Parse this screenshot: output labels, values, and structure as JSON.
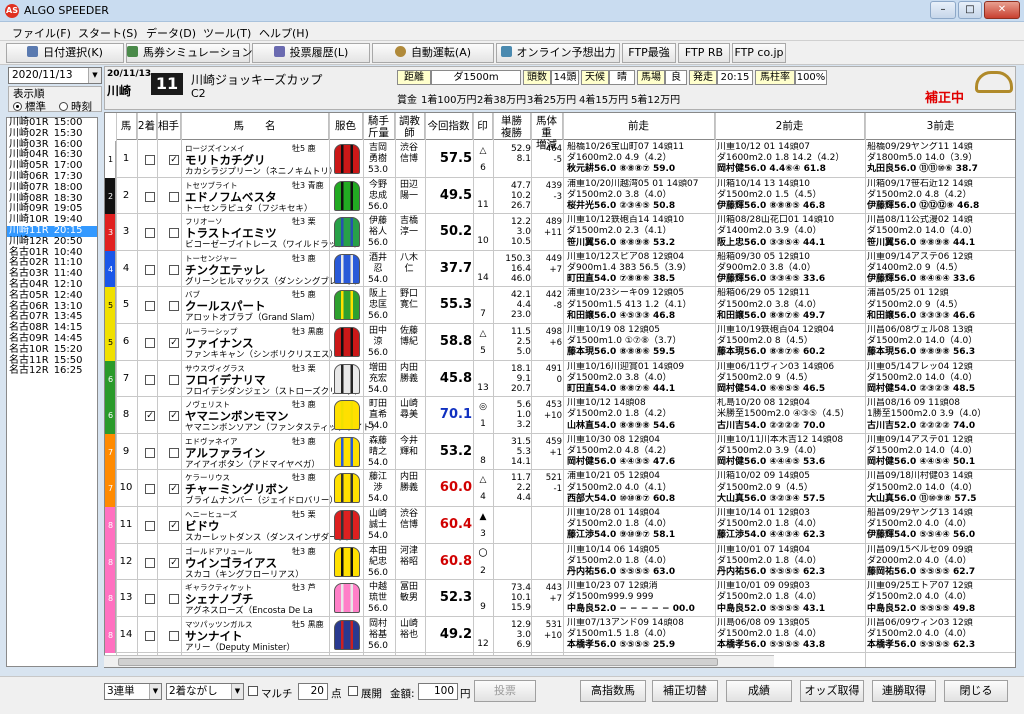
{
  "window": {
    "title": "ALGO SPEEDER",
    "logo_text": "AS",
    "min": "–",
    "max": "□",
    "close": "✕"
  },
  "menu": [
    "ファイル(F)",
    "スタート(S)",
    "データ(D)",
    "ツール(T)",
    "ヘルプ(H)"
  ],
  "toolbar": {
    "date_select": "日付選択(K)",
    "baken_sim": "馬券シミュレーション(B)",
    "history": "投票履歴(L)",
    "auto_vote": "自動運転(A)",
    "online": "オンライン予想出力",
    "ftp_strong": "FTP最強",
    "ftp_rb": "FTP RB",
    "ftp_cojp": "FTP co.jp"
  },
  "left": {
    "date": "2020/11/13",
    "sort_title": "表示順",
    "sort_std": "標準",
    "sort_time": "時刻",
    "races": [
      {
        "label": "川崎01R",
        "time": "15:00"
      },
      {
        "label": "川崎02R",
        "time": "15:30"
      },
      {
        "label": "川崎03R",
        "time": "16:00"
      },
      {
        "label": "川崎04R",
        "time": "16:30"
      },
      {
        "label": "川崎05R",
        "time": "17:00"
      },
      {
        "label": "川崎06R",
        "time": "17:30"
      },
      {
        "label": "川崎07R",
        "time": "18:00"
      },
      {
        "label": "川崎08R",
        "time": "18:30"
      },
      {
        "label": "川崎09R",
        "time": "19:05"
      },
      {
        "label": "川崎10R",
        "time": "19:40"
      },
      {
        "label": "川崎11R",
        "time": "20:15"
      },
      {
        "label": "川崎12R",
        "time": "20:50"
      },
      {
        "label": "名古01R",
        "time": "10:40"
      },
      {
        "label": "名古02R",
        "time": "11:10"
      },
      {
        "label": "名古03R",
        "time": "11:40"
      },
      {
        "label": "名古04R",
        "time": "12:10"
      },
      {
        "label": "名古05R",
        "time": "12:40"
      },
      {
        "label": "名古06R",
        "time": "13:10"
      },
      {
        "label": "名古07R",
        "time": "13:45"
      },
      {
        "label": "名古08R",
        "time": "14:15"
      },
      {
        "label": "名古09R",
        "time": "14:45"
      },
      {
        "label": "名古10R",
        "time": "15:20"
      },
      {
        "label": "名古11R",
        "time": "15:50"
      },
      {
        "label": "名古12R",
        "time": "16:25"
      }
    ]
  },
  "race": {
    "date": "20/11/13",
    "venue": "川崎",
    "num": "11",
    "name": "川崎ジョッキーズカップ",
    "class": "C2",
    "dist_label": "距離",
    "dist": "ダ1500m",
    "heads_label": "頭数",
    "heads": "14頭",
    "weather_label": "天候",
    "weather": "晴",
    "track_label": "馬場",
    "track": "良",
    "post_label": "発走",
    "post": "20:15",
    "rate_label": "馬柱率",
    "rate": "100%",
    "prize_label": "賞金",
    "p1": "1着100万円",
    "p2": "2着38万円",
    "p3": "3着25万円",
    "p4": "4着15万円",
    "p5": "5着12万円",
    "hosei": "補正中"
  },
  "cols": {
    "uma": "馬",
    "second": "2着",
    "aite": "相手",
    "name": "馬　　名",
    "silk": "服色",
    "jockey": "騎手\n斤量",
    "trainer": "調教\n師",
    "index": "今回指数",
    "mark": "印",
    "odds": "単勝\n複勝",
    "weight": "馬体重\n増減",
    "prev1": "前走",
    "prev2": "2前走",
    "prev3": "3前走"
  },
  "horses": [
    {
      "waku": "1",
      "num": "1",
      "c2": false,
      "aite": true,
      "sire": "ロージズインメイ",
      "name": "モリトカチグリ",
      "dam": "カカシラジプリーン（ネニノキムトリ）",
      "sexage": "牡5 鹿",
      "jockey": "吉岡\n勇樹\n53.0",
      "trainer": "渋谷\n信博",
      "score": "57.5",
      "mark": "△",
      "mark2": "6",
      "odds": "52.9\n8.1",
      "wt": "464\n-5",
      "p1": [
        "船橋10/26宝山町07 14頭11",
        "ダ1600m2.0 4.9（4.2）",
        "秋元耕56.0 ⑧⑧⑧⑦ 59.0"
      ],
      "p2": [
        "川重10/12 01 14頭07",
        "ダ1600m2.0 1.8 14.2（4.2）",
        "岡村健56.0 4.4⑥④ 61.8"
      ],
      "p3": [
        "船橋09/29ヤング11 14頭",
        "ダ1800m5.0 14.0（3.9）",
        "丸田良56.0 ⑪⑪⑩⑥ 38.7"
      ]
    },
    {
      "waku": "2",
      "num": "2",
      "c2": false,
      "aite": false,
      "sire": "トセツブライト",
      "name": "エドノフムベスタ",
      "dam": "トーセンラピュタ（フジキセキ）",
      "sexage": "牡3 青鹿",
      "jockey": "今野\n忠成\n56.0",
      "trainer": "田辺\n陽一",
      "score": "49.5",
      "mark": "",
      "mark2": "11",
      "odds": "47.7\n10.2\n26.7",
      "wt": "439\n-3",
      "p1": [
        "浦重10/20川越湾05 01 14頭07",
        "ダ1500m2.0 3.8（4.0）",
        "桜井光56.0 ②③④⑤ 50.8"
      ],
      "p2": [
        "川箱10/14 13 14頭10",
        "ダ1500m2.0 1.5（4.5）",
        "伊藤輝56.0 ⑧⑧⑧⑤ 46.8"
      ],
      "p3": [
        "川箱09/17笹石近12 14頭",
        "ダ1500m2.0 4.8（4.2）",
        "伊藤輝56.0 ⑫⑫⑫⑧ 46.8"
      ]
    },
    {
      "waku": "3",
      "num": "3",
      "c2": false,
      "aite": false,
      "sire": "フリオーソ",
      "name": "トラストイエミツ",
      "dam": "ビコーゼーブイトレース（ワイルドラッシュ）",
      "sexage": "牡3 栗",
      "jockey": "伊藤\n裕人\n56.0",
      "trainer": "吉橋\n淳一",
      "score": "50.2",
      "mark": "",
      "mark2": "10",
      "odds": "12.2\n3.0\n10.5",
      "wt": "489\n+11",
      "p1": [
        "川重10/12鉄砲百14 14頭10",
        "ダ1500m2.0 2.3（4.1）",
        "笹川翼56.0 ⑧⑧⑨⑧ 53.2"
      ],
      "p2": [
        "川箱08/28山花口01 14頭10",
        "ダ1400m2.0 3.9（4.0）",
        "阪上忠56.0 ③③⑤④ 44.1"
      ],
      "p3": [
        "川昌08/11公式漫02 14頭",
        "ダ1500m2.0 14.0（4.0）",
        "笹川翼56.0 ⑨⑧⑨⑧ 44.1"
      ]
    },
    {
      "waku": "4",
      "num": "4",
      "c2": false,
      "aite": false,
      "sire": "トーセンジャー",
      "name": "チンクエテッレ",
      "dam": "グリーンヒルマックス（ダンシングブレーヴ）",
      "sexage": "牡3 鹿",
      "jockey": "酒井\n忍\n54.0",
      "trainer": "八木\n仁",
      "score": "37.7",
      "mark": "",
      "mark2": "14",
      "odds": "150.3\n16.4\n46.0",
      "wt": "449\n+7",
      "p1": [
        "川重10/12スピア08 12頭04",
        "ダ900m1.4 383 56.5（3.9）",
        "町田直54.0 ⑦⑧⑧⑥ 38.5"
      ],
      "p2": [
        "船箱09/30 05 12頭10",
        "ダ900m2.0 3.8（4.0）",
        "伊藤輝56.0 ③③④⑤ 33.6"
      ],
      "p3": [
        "川重09/14アステ06 12頭",
        "ダ1400m2.0 9（4.5）",
        "伊藤輝56.0 ⑧④⑥④ 33.6"
      ]
    },
    {
      "waku": "5",
      "num": "5",
      "c2": false,
      "aite": false,
      "sire": "バブ",
      "name": "クールスパート",
      "dam": "アロットオブラブ（Grand Slam）",
      "sexage": "牡5 鹿",
      "jockey": "阪上\n忠匡\n56.0",
      "trainer": "野口\n寛仁",
      "score": "55.3",
      "mark": "",
      "mark2": "7",
      "odds": "42.1\n4.4\n23.0",
      "wt": "442\n-8",
      "p1": [
        "浦重10/23シーキ09 12頭05",
        "ダ1500m1.5 413 1.2（4.1）",
        "和田譲56.0 ④⑤③③ 46.8"
      ],
      "p2": [
        "船箱06/29 05 12頭11",
        "ダ1500m2.0 3.8（4.0）",
        "和田譲56.0 ⑧⑧⑦⑥ 49.7"
      ],
      "p3": [
        "浦昌05/25 01 12頭",
        "ダ1500m2.0 9（4.5）",
        "和田譲56.0 ③③③③ 46.6"
      ]
    },
    {
      "waku": "5",
      "num": "6",
      "c2": false,
      "aite": true,
      "sire": "ルーラーシップ",
      "name": "ファイナンス",
      "dam": "ファンキキャン（シンボリクリスエス）",
      "sexage": "牡3 黒鹿",
      "jockey": "田中\n涼\n56.0",
      "trainer": "佐藤\n博紀",
      "score": "58.8",
      "mark": "△",
      "mark2": "5",
      "odds": "11.5\n2.5\n5.0",
      "wt": "498\n+6",
      "p1": [
        "川重10/19 08 12頭05",
        "ダ1500m1.0 ①⑦⑧（3.7）",
        "藤本現56.0 ⑧⑧⑧⑥ 59.5"
      ],
      "p2": [
        "川重10/19鉄砲百04 12頭04",
        "ダ1500m2.0 8（4.5）",
        "藤本現56.0 ⑧⑧⑦⑥ 60.2"
      ],
      "p3": [
        "川昌06/08ヴェル08 13頭",
        "ダ1500m2.0 14.0（4.0）",
        "藤本現56.0 ⑨⑧⑨⑧ 56.3"
      ]
    },
    {
      "waku": "6",
      "num": "7",
      "c2": false,
      "aite": false,
      "sire": "サウスヴィグラス",
      "name": "フロイデナリマ",
      "dam": "フロイデシダンジェン（ストローズクリーク）",
      "sexage": "牡3 栗",
      "jockey": "増田\n充宏\n54.0",
      "trainer": "内田\n勝義",
      "score": "45.8",
      "mark": "",
      "mark2": "13",
      "odds": "18.1\n9.1\n20.7",
      "wt": "491\n0",
      "p1": [
        "川重10/16川迎賞01 14頭09",
        "ダ1500m2.0 3.8（4.0）",
        "町田直54.0 ⑧⑧⑦⑥ 44.1"
      ],
      "p2": [
        "川重06/11ヴィン03 14頭06",
        "ダ1500m2.0 9（4.5）",
        "岡村健54.0 ⑥⑥⑤⑤ 46.5"
      ],
      "p3": [
        "川重05/14ブレッ04 12頭",
        "ダ1500m2.0 14.0（4.0）",
        "岡村健54.0 ②③②③ 48.5"
      ]
    },
    {
      "waku": "6",
      "num": "8",
      "c2": true,
      "aite": true,
      "sire": "ノヴェリスト",
      "name": "ヤマニンボンモマン",
      "dam": "ヤマニンボンソアン（ファンタスティックライト）",
      "sexage": "牡3 鹿",
      "jockey": "町田\n直希\n54.0",
      "trainer": "山崎\n尋美",
      "score": "70.1",
      "mark": "◎",
      "mark2": "1",
      "odds": "5.6\n1.0\n3.2",
      "wt": "453\n+10",
      "p1": [
        "川重10/12 14頭08",
        "ダ1500m2.0 1.8（4.2）",
        "山林直54.0 ⑧⑧⑨⑧ 54.6"
      ],
      "p2": [
        "札島10/20 08 12頭04",
        "米勝至1500m2.0 ④③⑤（4.5）",
        "古川吉54.0 ②②②② 70.0"
      ],
      "p3": [
        "川昌08/16 09 11頭08",
        "1勝至1500m2.0 3.9（4.0）",
        "古川吉52.0 ②②②② 74.0"
      ]
    },
    {
      "waku": "7",
      "num": "9",
      "c2": false,
      "aite": false,
      "sire": "エドヴァネイア",
      "name": "アルファライン",
      "dam": "アイアイボタン（アドマイヤベガ）",
      "sexage": "牡3 鹿",
      "jockey": "森藤\n晴之\n54.0",
      "trainer": "今井\n輝和",
      "score": "53.2",
      "mark": "",
      "mark2": "8",
      "odds": "31.5\n5.3\n14.1",
      "wt": "459\n+1",
      "p1": [
        "川重10/30 08 12頭04",
        "ダ1500m2.0 4.8（4.2）",
        "岡村健56.0 ④④③⑤ 47.6"
      ],
      "p2": [
        "川重10/11川本木吉12 14頭08",
        "ダ1500m2.0 3.9（4.0）",
        "岡村健56.0 ④④④⑤ 53.6"
      ],
      "p3": [
        "川重09/14アステ01 12頭",
        "ダ1500m2.0 14.0（4.0）",
        "岡村健56.0 ④④⑤④ 50.1"
      ]
    },
    {
      "waku": "7",
      "num": "10",
      "c2": false,
      "aite": true,
      "sire": "ケラーリウス",
      "name": "チャーミングリボン",
      "dam": "ブライムナンバー（ジェイドロバリー）",
      "sexage": "牡3 鹿",
      "jockey": "藤江\n渉\n54.0",
      "trainer": "内田\n勝義",
      "score": "60.0",
      "mark": "△",
      "mark2": "4",
      "odds": "11.7\n2.2\n4.4",
      "wt": "521\n-1",
      "p1": [
        "浦重10/21 05 12頭04",
        "ダ1500m2.0 4.0（4.1）",
        "西部大54.0 ⑩⑩⑧⑦ 60.8"
      ],
      "p2": [
        "川箱10/02 09 14頭05",
        "ダ1500m2.0 9（4.5）",
        "大山真56.0 ③②③④ 57.5"
      ],
      "p3": [
        "川昌09/18川村健03 14頭",
        "ダ1500m2.0 14.0（4.0）",
        "大山真56.0 ⑪⑩⑨⑧ 57.5"
      ]
    },
    {
      "waku": "8",
      "num": "11",
      "c2": false,
      "aite": true,
      "sire": "ヘニーヒューズ",
      "name": "ビドウ",
      "dam": "スカーレットダンス（ダンスインザダーク）",
      "sexage": "牡5 栗",
      "jockey": "山崎\n誠士\n54.0",
      "trainer": "渋谷\n信博",
      "score": "60.4",
      "mark": "▲",
      "mark2": "3",
      "odds": "",
      "wt": "",
      "p1": [
        "川重10/28 01 14頭04",
        "ダ1500m2.0 1.8（4.0）",
        "藤江渉54.0 ⑨⑩⑨⑦ 58.1"
      ],
      "p2": [
        "川重10/14 01 12頭03",
        "ダ1500m2.0 1.8（4.0）",
        "藤江渉54.0 ④④③④ 62.3"
      ],
      "p3": [
        "船昌09/29ヤング13 14頭",
        "ダ1500m2.0 4.0（4.0）",
        "伊藤輝54.0 ⑤⑤④④ 56.0"
      ]
    },
    {
      "waku": "8",
      "num": "12",
      "c2": false,
      "aite": true,
      "sire": "ゴールドアリュール",
      "name": "ウインゴライアス",
      "dam": "スカコ（キングフローリアス）",
      "sexage": "牡3 鹿",
      "jockey": "本田\n紀忠\n56.0",
      "trainer": "河津\n裕昭",
      "score": "60.8",
      "mark": "〇",
      "mark2": "2",
      "odds": "",
      "wt": "",
      "p1": [
        "川重10/14 06 14頭05",
        "ダ1500m2.0 1.8（4.0）",
        "丹内祐56.0 ⑤⑤⑤⑤ 63.0"
      ],
      "p2": [
        "川重10/01 07 14頭04",
        "ダ1500m2.0 1.8（4.0）",
        "丹内祐56.0 ⑤⑤⑤⑤ 62.3"
      ],
      "p3": [
        "川昌09/15ベルセ09 09頭",
        "ダ2000m2.0 4.0（4.0）",
        "藤岡祐56.0 ⑤⑤⑤⑤ 62.7"
      ]
    },
    {
      "waku": "8",
      "num": "13",
      "c2": false,
      "aite": false,
      "sire": "ギャラクティケット",
      "name": "シェナノブチ",
      "dam": "アグネスローズ（Encosta De La",
      "sexage": "牡3 芦",
      "jockey": "中越\n琉世\n56.0",
      "trainer": "冨田\n敏男",
      "score": "52.3",
      "mark": "",
      "mark2": "9",
      "odds": "73.4\n10.1\n15.9",
      "wt": "443\n+7",
      "p1": [
        "川重10/23 07 12頭消",
        "ダ1500m999.9 999",
        "中島良52.0 − − − − − 00.0"
      ],
      "p2": [
        "川重10/01 09 09頭03",
        "ダ1500m2.0 1.8（4.0）",
        "中島良52.0 ⑤⑤⑤⑤ 43.1"
      ],
      "p3": [
        "川重09/25エトア07 12頭",
        "ダ1500m2.0 4.0（4.0）",
        "中島良52.0 ⑤⑤⑤⑤ 49.8"
      ]
    },
    {
      "waku": "8",
      "num": "14",
      "c2": false,
      "aite": false,
      "sire": "マツパッツンガルス",
      "name": "サンナイト",
      "dam": "アリー（Deputy Minister）",
      "sexage": "牡5 黒鹿",
      "jockey": "岡村\n裕基\n56.0",
      "trainer": "山崎\n裕也",
      "score": "49.2",
      "mark": "",
      "mark2": "12",
      "odds": "12.9\n3.0\n6.9",
      "wt": "531\n+10",
      "p1": [
        "川重07/13アンド09 14頭08",
        "ダ1500m1.5 1.8（4.0）",
        "本橋孝56.0 ⑤⑤⑤⑤ 25.9"
      ],
      "p2": [
        "川島06/08 09 13頭05",
        "ダ1500m2.0 1.8（4.0）",
        "本橋孝56.0 ⑤⑤⑤⑤ 43.8"
      ],
      "p3": [
        "川昌06/09ウィン03 12頭",
        "ダ1500m2.0 4.0（4.0）",
        "本橋孝56.0 ⑤⑤⑤⑤ 62.3"
      ]
    }
  ],
  "bottom": {
    "bet_type": "3連単",
    "method": "2着ながし",
    "multi": "マルチ",
    "points_val": "20",
    "points": "点",
    "expand": "展開",
    "amount_label": "金額:",
    "amount": "100",
    "yen": "円",
    "vote": "投票",
    "sort_idx": "高指数馬",
    "hosei_btn": "補正切替",
    "result": "成績",
    "odds_get": "オッズ取得",
    "renpai": "連勝取得",
    "close": "閉じる"
  }
}
